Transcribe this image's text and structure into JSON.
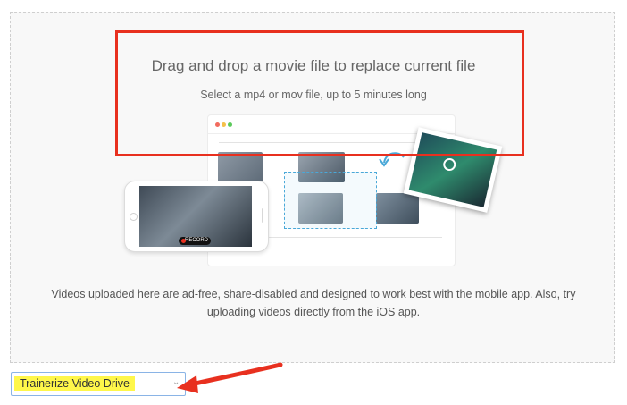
{
  "dropzone": {
    "title": "Drag and drop a movie file to replace current file",
    "subtitle": "Select a mp4 or mov file, up to 5 minutes long",
    "info": "Videos uploaded here are ad-free, share-disabled and designed to work best with the mobile app. Also, try uploading videos directly from the iOS app."
  },
  "illustration": {
    "phone_badge": "RECORD",
    "icons": [
      "play-icon",
      "upload-arrow-icon"
    ]
  },
  "dropdown": {
    "selected": "Trainerize Video Drive",
    "chevron_icon": "chevron-down-icon"
  },
  "colors": {
    "highlight_box": "#e8301f",
    "arrow": "#e8301f",
    "label_highlight": "#fff74a",
    "select_border": "#8ab4e6"
  }
}
